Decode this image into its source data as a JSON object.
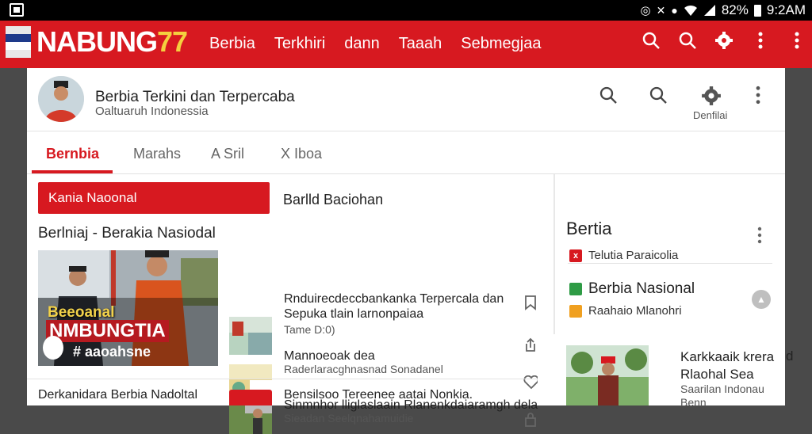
{
  "statusbar": {
    "left_icon": "screenshot-icon",
    "battery": "82%",
    "time": "9:2AM"
  },
  "brand": {
    "name_letters": "NABUNG",
    "name_number": "77"
  },
  "topnav": {
    "items": [
      "Berbia",
      "Terkhiri",
      "dann",
      "Taaah",
      "Sebmegjaa"
    ]
  },
  "header": {
    "title": "Berbia Terkini dan Terpercaba",
    "subtitle": "Oaltuaruh Indonessia",
    "settings_label": "Denfilai"
  },
  "tabs": [
    "Bernbia",
    "Marahs",
    "A Sril",
    "X Iboa"
  ],
  "main": {
    "red_label": "Kania Naoonal",
    "section_title": "Barlld Baciohan",
    "headline": "Berlniaj - Berakia Nasiodal",
    "hero": {
      "cap1": "Beeoanal",
      "cap2": "NMBUNGTIA",
      "cap3": "# aaoahsne"
    },
    "articles": [
      {
        "title": "Rnduirecdeccbankanka Terpercala dan",
        "title2": "Sepuka tlain larnonpaiaa",
        "meta": "Tame D:0)"
      },
      {
        "title": "Mannoeoak dea",
        "meta": "Raderlaracghnasnad Sonadanel"
      },
      {
        "title": "Sinmnhor lliglaslaain Rlanenkdaiaramgh dela",
        "meta": "Sieadan  Seelqnahamuidie"
      }
    ],
    "bottom_left": "Derkanidara Berbia Nadoltal",
    "bottom_right": "Bensilsoo Tereenee aatai Nonkia."
  },
  "right": {
    "title": "Bertia",
    "rows": [
      {
        "text": "Telutia Paraicolia",
        "badge": "x"
      },
      {
        "text": "Berbia Nasional",
        "badge": ""
      },
      {
        "text": "Raahaio Mlanohri",
        "badge": ""
      }
    ],
    "card": {
      "title1": "Karkkaaik krera",
      "title2": "Rlaohal Sea",
      "sub1": "Saarilan Indonau",
      "sub2": "Benn",
      "side": "d"
    }
  },
  "colors": {
    "brand_red": "#d71920",
    "brand_yellow": "#f4d03f",
    "green": "#2e9b45",
    "orange": "#f0a020"
  }
}
